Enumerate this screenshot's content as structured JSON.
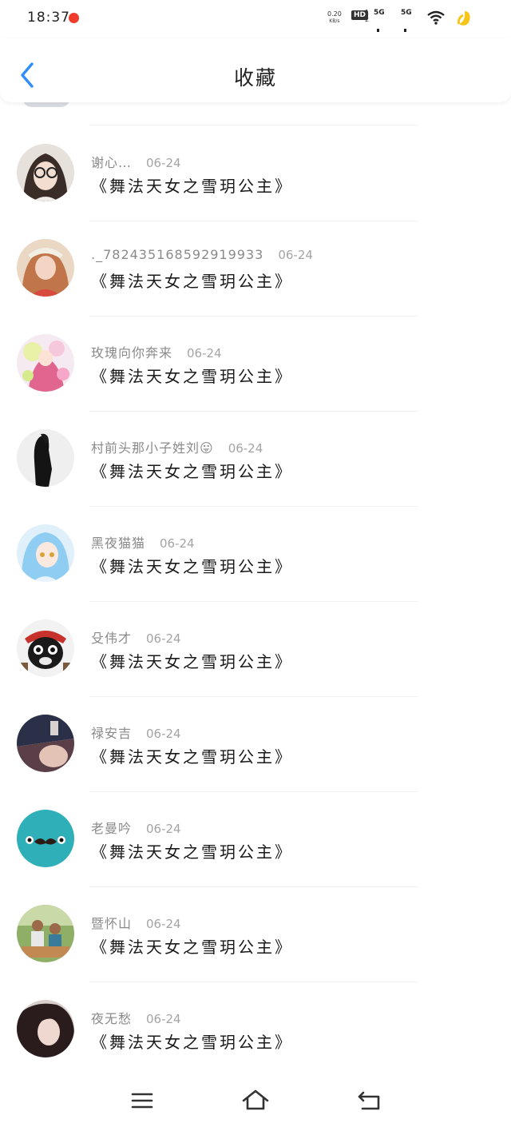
{
  "status_bar": {
    "time": "18:37",
    "net_speed_value": "0.20",
    "net_speed_unit": "KB/s",
    "hd_label": "HD",
    "hd_sub": "1\n2",
    "sim1_label": "5G",
    "sim2_label": "5G"
  },
  "header": {
    "title": "收藏"
  },
  "items": [
    {
      "name": "谢心…",
      "date": "06-24",
      "content": "《舞法天女之雪玥公主》"
    },
    {
      "name": "._782435168592919933",
      "date": "06-24",
      "content": "《舞法天女之雪玥公主》"
    },
    {
      "name": "玫瑰向你奔来",
      "date": "06-24",
      "content": "《舞法天女之雪玥公主》"
    },
    {
      "name": "村前头那小子姓刘😛",
      "date": "06-24",
      "content": "《舞法天女之雪玥公主》"
    },
    {
      "name": "黑夜猫猫",
      "date": "06-24",
      "content": "《舞法天女之雪玥公主》"
    },
    {
      "name": "殳伟才",
      "date": "06-24",
      "content": "《舞法天女之雪玥公主》"
    },
    {
      "name": "禄安吉",
      "date": "06-24",
      "content": "《舞法天女之雪玥公主》"
    },
    {
      "name": "老曼吟",
      "date": "06-24",
      "content": "《舞法天女之雪玥公主》"
    },
    {
      "name": "暨怀山",
      "date": "06-24",
      "content": "《舞法天女之雪玥公主》"
    },
    {
      "name": "夜无愁",
      "date": "06-24",
      "content": "《舞法天女之雪玥公主》"
    }
  ],
  "colors": {
    "accent": "#2f8ef7",
    "title_text": "#222222",
    "meta_text": "#8a8a8a"
  },
  "icons": {
    "back": "chevron-left-icon",
    "nav_menu": "menu-icon",
    "nav_home": "home-icon",
    "nav_back": "return-icon"
  }
}
